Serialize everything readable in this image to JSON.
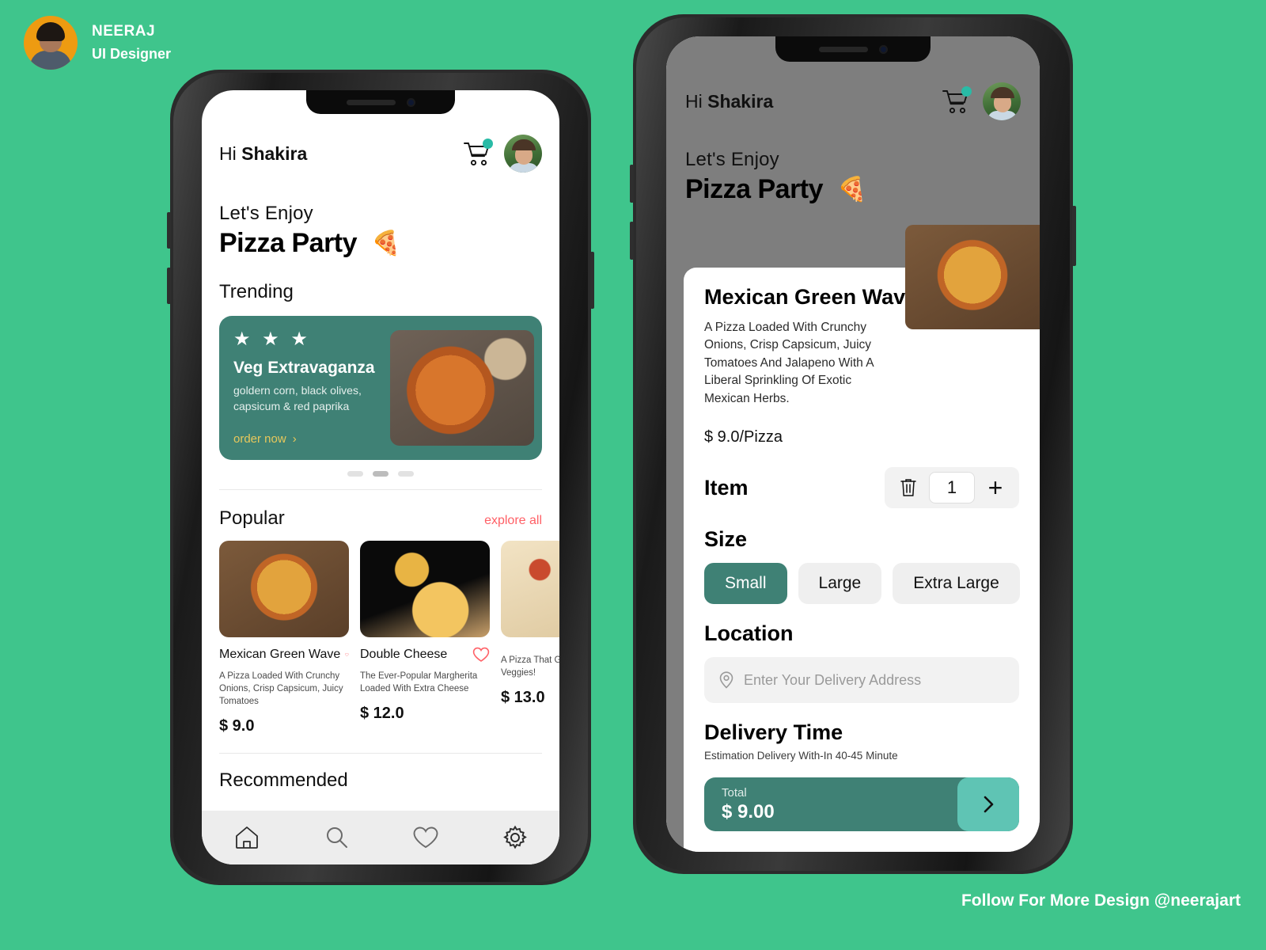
{
  "designer": {
    "name": "NEERAJ",
    "role": "UI Designer",
    "avatar_icon": "designer-avatar"
  },
  "footer": {
    "text": "Follow For More Design @neerajart"
  },
  "colors": {
    "background": "#3FC58C",
    "brand_teal": "#3F8175",
    "accent_mint": "#5FC4B4",
    "accent_red": "#FF6066",
    "cart_dot": "#29BBA6",
    "cta_yellow": "#E8C85B",
    "dim_overlay": "#7E7E7E"
  },
  "home": {
    "greeting_prefix": "Hi ",
    "user_name": "Shakira",
    "cart_icon": "cart-icon",
    "avatar_icon": "user-avatar",
    "hero_sub": "Let's Enjoy",
    "hero_title": "Pizza Party",
    "hero_emoji": "🍕",
    "trending_label": "Trending",
    "trending_card": {
      "stars": "★ ★ ★",
      "name": "Veg Extravaganza",
      "desc": "goldern corn, black olives, capsicum & red paprika",
      "cta": "order now",
      "cta_chevron": "›"
    },
    "carousel": {
      "count": 3,
      "active_index": 1
    },
    "popular_label": "Popular",
    "explore_all": "explore all",
    "popular_items": [
      {
        "title": "Mexican Green Wave",
        "desc": "A Pizza Loaded With Crunchy Onions, Crisp Capsicum, Juicy Tomatoes",
        "price": "$ 9.0",
        "fav_icon": "heart-icon"
      },
      {
        "title": "Double Cheese",
        "desc": "The Ever-Popular Margherita Loaded With Extra Cheese",
        "price": "$ 12.0",
        "fav_icon": "heart-icon"
      },
      {
        "title": "",
        "desc": "A Pizza That Goes Ballistic On Veggies!",
        "price": "$ 13.0",
        "fav_icon": "heart-icon"
      }
    ],
    "recommended_label": "Recommended",
    "tabbar": [
      {
        "icon": "home-icon",
        "label": "Home"
      },
      {
        "icon": "search-icon",
        "label": "Search"
      },
      {
        "icon": "heart-icon",
        "label": "Favorites"
      },
      {
        "icon": "gear-icon",
        "label": "Settings"
      }
    ]
  },
  "detail": {
    "greeting_prefix": "Hi ",
    "user_name": "Shakira",
    "cart_icon": "cart-icon",
    "avatar_icon": "user-avatar",
    "hero_sub": "Let's Enjoy",
    "hero_title": "Pizza Party",
    "hero_emoji": "🍕",
    "product_title": "Mexican Green Wave",
    "product_desc": "A Pizza Loaded With Crunchy Onions, Crisp Capsicum, Juicy Tomatoes And Jalapeno With A Liberal Sprinkling Of Exotic Mexican Herbs.",
    "product_price": "$ 9.0/Pizza",
    "item_label": "Item",
    "delete_icon": "trash-icon",
    "quantity": "1",
    "plus_icon": "plus-icon",
    "size_label": "Size",
    "sizes": [
      {
        "label": "Small",
        "selected": true
      },
      {
        "label": "Large",
        "selected": false
      },
      {
        "label": "Extra Large",
        "selected": false
      }
    ],
    "location_label": "Location",
    "location_icon": "map-pin-icon",
    "location_placeholder": "Enter Your Delivery Address",
    "location_value": "",
    "delivery_label": "Delivery Time",
    "delivery_note": "Estimation Delivery With-In 40-45 Minute",
    "total_label": "Total",
    "total_value": "$ 9.00",
    "go_icon": "chevron-right-icon"
  }
}
